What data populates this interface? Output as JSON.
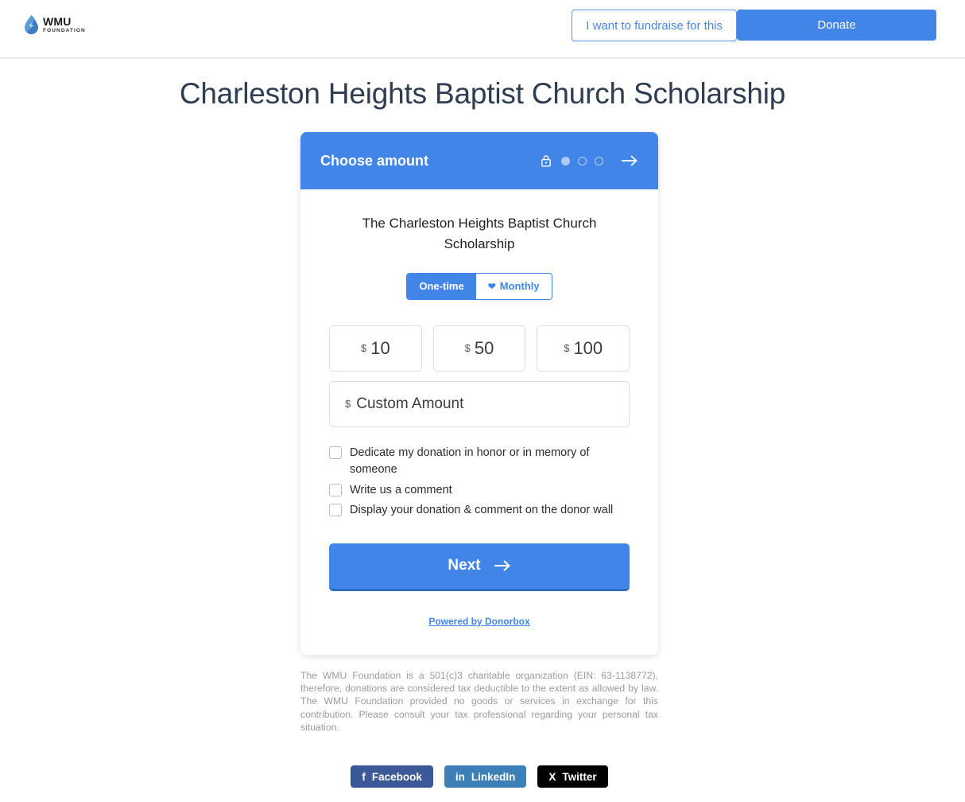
{
  "colors": {
    "accent": "#4285e8",
    "accent_dark": "#2f6cc4",
    "title": "#2e3d50",
    "facebook": "#3b5998",
    "linkedin": "#3d80b7",
    "twitter": "#000000"
  },
  "header": {
    "logo_name": "WMU",
    "logo_sub": "FOUNDATION",
    "fundraise_label": "I want to fundraise for this",
    "donate_label": "Donate"
  },
  "page": {
    "title": "Charleston Heights Baptist Church Scholarship"
  },
  "widget": {
    "step_title": "Choose amount",
    "steps_total": 3,
    "step_current": 1,
    "campaign_name": "The Charleston Heights Baptist Church Scholarship",
    "frequency": {
      "one_time_label": "One-time",
      "monthly_label": "Monthly",
      "selected": "One-time"
    },
    "currency_symbol": "$",
    "amounts": [
      "10",
      "50",
      "100"
    ],
    "custom_amount": {
      "value": "",
      "placeholder": "Custom Amount"
    },
    "checkboxes": [
      {
        "label": "Dedicate my donation in honor or in memory of someone",
        "checked": false
      },
      {
        "label": "Write us a comment",
        "checked": false
      },
      {
        "label": "Display your donation & comment on the donor wall",
        "checked": false
      }
    ],
    "next_label": "Next",
    "powered_by": "Powered by Donorbox"
  },
  "disclaimer": "The WMU Foundation is a 501(c)3 charitable organization (EIN: 63-1138772), therefore, donations are considered tax deductible to the extent as allowed by law. The WMU Foundation provided no goods or services in exchange for this contribution. Please consult your tax professional regarding your personal tax situation.",
  "social": [
    {
      "label": "Facebook",
      "icon": "facebook-icon",
      "glyph": "f"
    },
    {
      "label": "LinkedIn",
      "icon": "linkedin-icon",
      "glyph": "in"
    },
    {
      "label": "Twitter",
      "icon": "twitter-x-icon",
      "glyph": "X"
    }
  ]
}
